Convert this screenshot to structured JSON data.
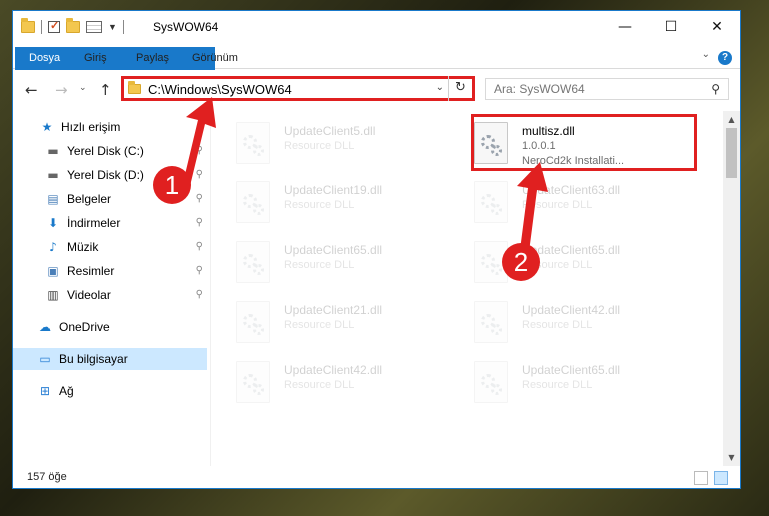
{
  "window": {
    "title": "SysWOW64",
    "controls": {
      "minimize": "—",
      "maximize": "☐",
      "close": "✕"
    }
  },
  "ribbon": {
    "tabs": [
      "Dosya",
      "Giriş",
      "Paylaş",
      "Görünüm"
    ],
    "help": "?"
  },
  "address": {
    "path": "C:\\Windows\\SysWOW64",
    "search_placeholder": "Ara: SysWOW64"
  },
  "sidebar": {
    "items": [
      {
        "label": "Hızlı erişim",
        "icon": "star-icon"
      },
      {
        "label": "Yerel Disk (C:)",
        "icon": "drive-icon"
      },
      {
        "label": "Yerel Disk (D:)",
        "icon": "drive-icon"
      },
      {
        "label": "Belgeler",
        "icon": "documents-icon"
      },
      {
        "label": "İndirmeler",
        "icon": "download-icon"
      },
      {
        "label": "Müzik",
        "icon": "music-icon"
      },
      {
        "label": "Resimler",
        "icon": "pictures-icon"
      },
      {
        "label": "Videolar",
        "icon": "video-icon"
      },
      {
        "label": "OneDrive",
        "icon": "cloud-icon"
      },
      {
        "label": "Bu bilgisayar",
        "icon": "computer-icon"
      },
      {
        "label": "Ağ",
        "icon": "network-icon"
      }
    ]
  },
  "files": [
    {
      "name": "UpdateClient5.dll",
      "line1": "Resource DLL",
      "line2": ""
    },
    {
      "name": "multisz.dll",
      "line1": "1.0.0.1",
      "line2": "NeroCd2k Installati..."
    },
    {
      "name": "UpdateClient19.dll",
      "line1": "Resource DLL",
      "line2": ""
    },
    {
      "name": "UpdateClient63.dll",
      "line1": "Resource DLL",
      "line2": ""
    },
    {
      "name": "UpdateClient65.dll",
      "line1": "Resource DLL",
      "line2": ""
    },
    {
      "name": "UpdateClient65.dll",
      "line1": "Resource DLL",
      "line2": ""
    },
    {
      "name": "UpdateClient21.dll",
      "line1": "Resource DLL",
      "line2": ""
    },
    {
      "name": "UpdateClient42.dll",
      "line1": "Resource DLL",
      "line2": ""
    },
    {
      "name": "UpdateClient42.dll",
      "line1": "Resource DLL",
      "line2": ""
    },
    {
      "name": "UpdateClient65.dll",
      "line1": "Resource DLL",
      "line2": ""
    }
  ],
  "status": {
    "count": "157 öğe"
  },
  "callouts": {
    "one": "1",
    "two": "2"
  },
  "colors": {
    "accent": "#1979ca",
    "highlight": "#e02020",
    "selected": "#cce8ff"
  }
}
